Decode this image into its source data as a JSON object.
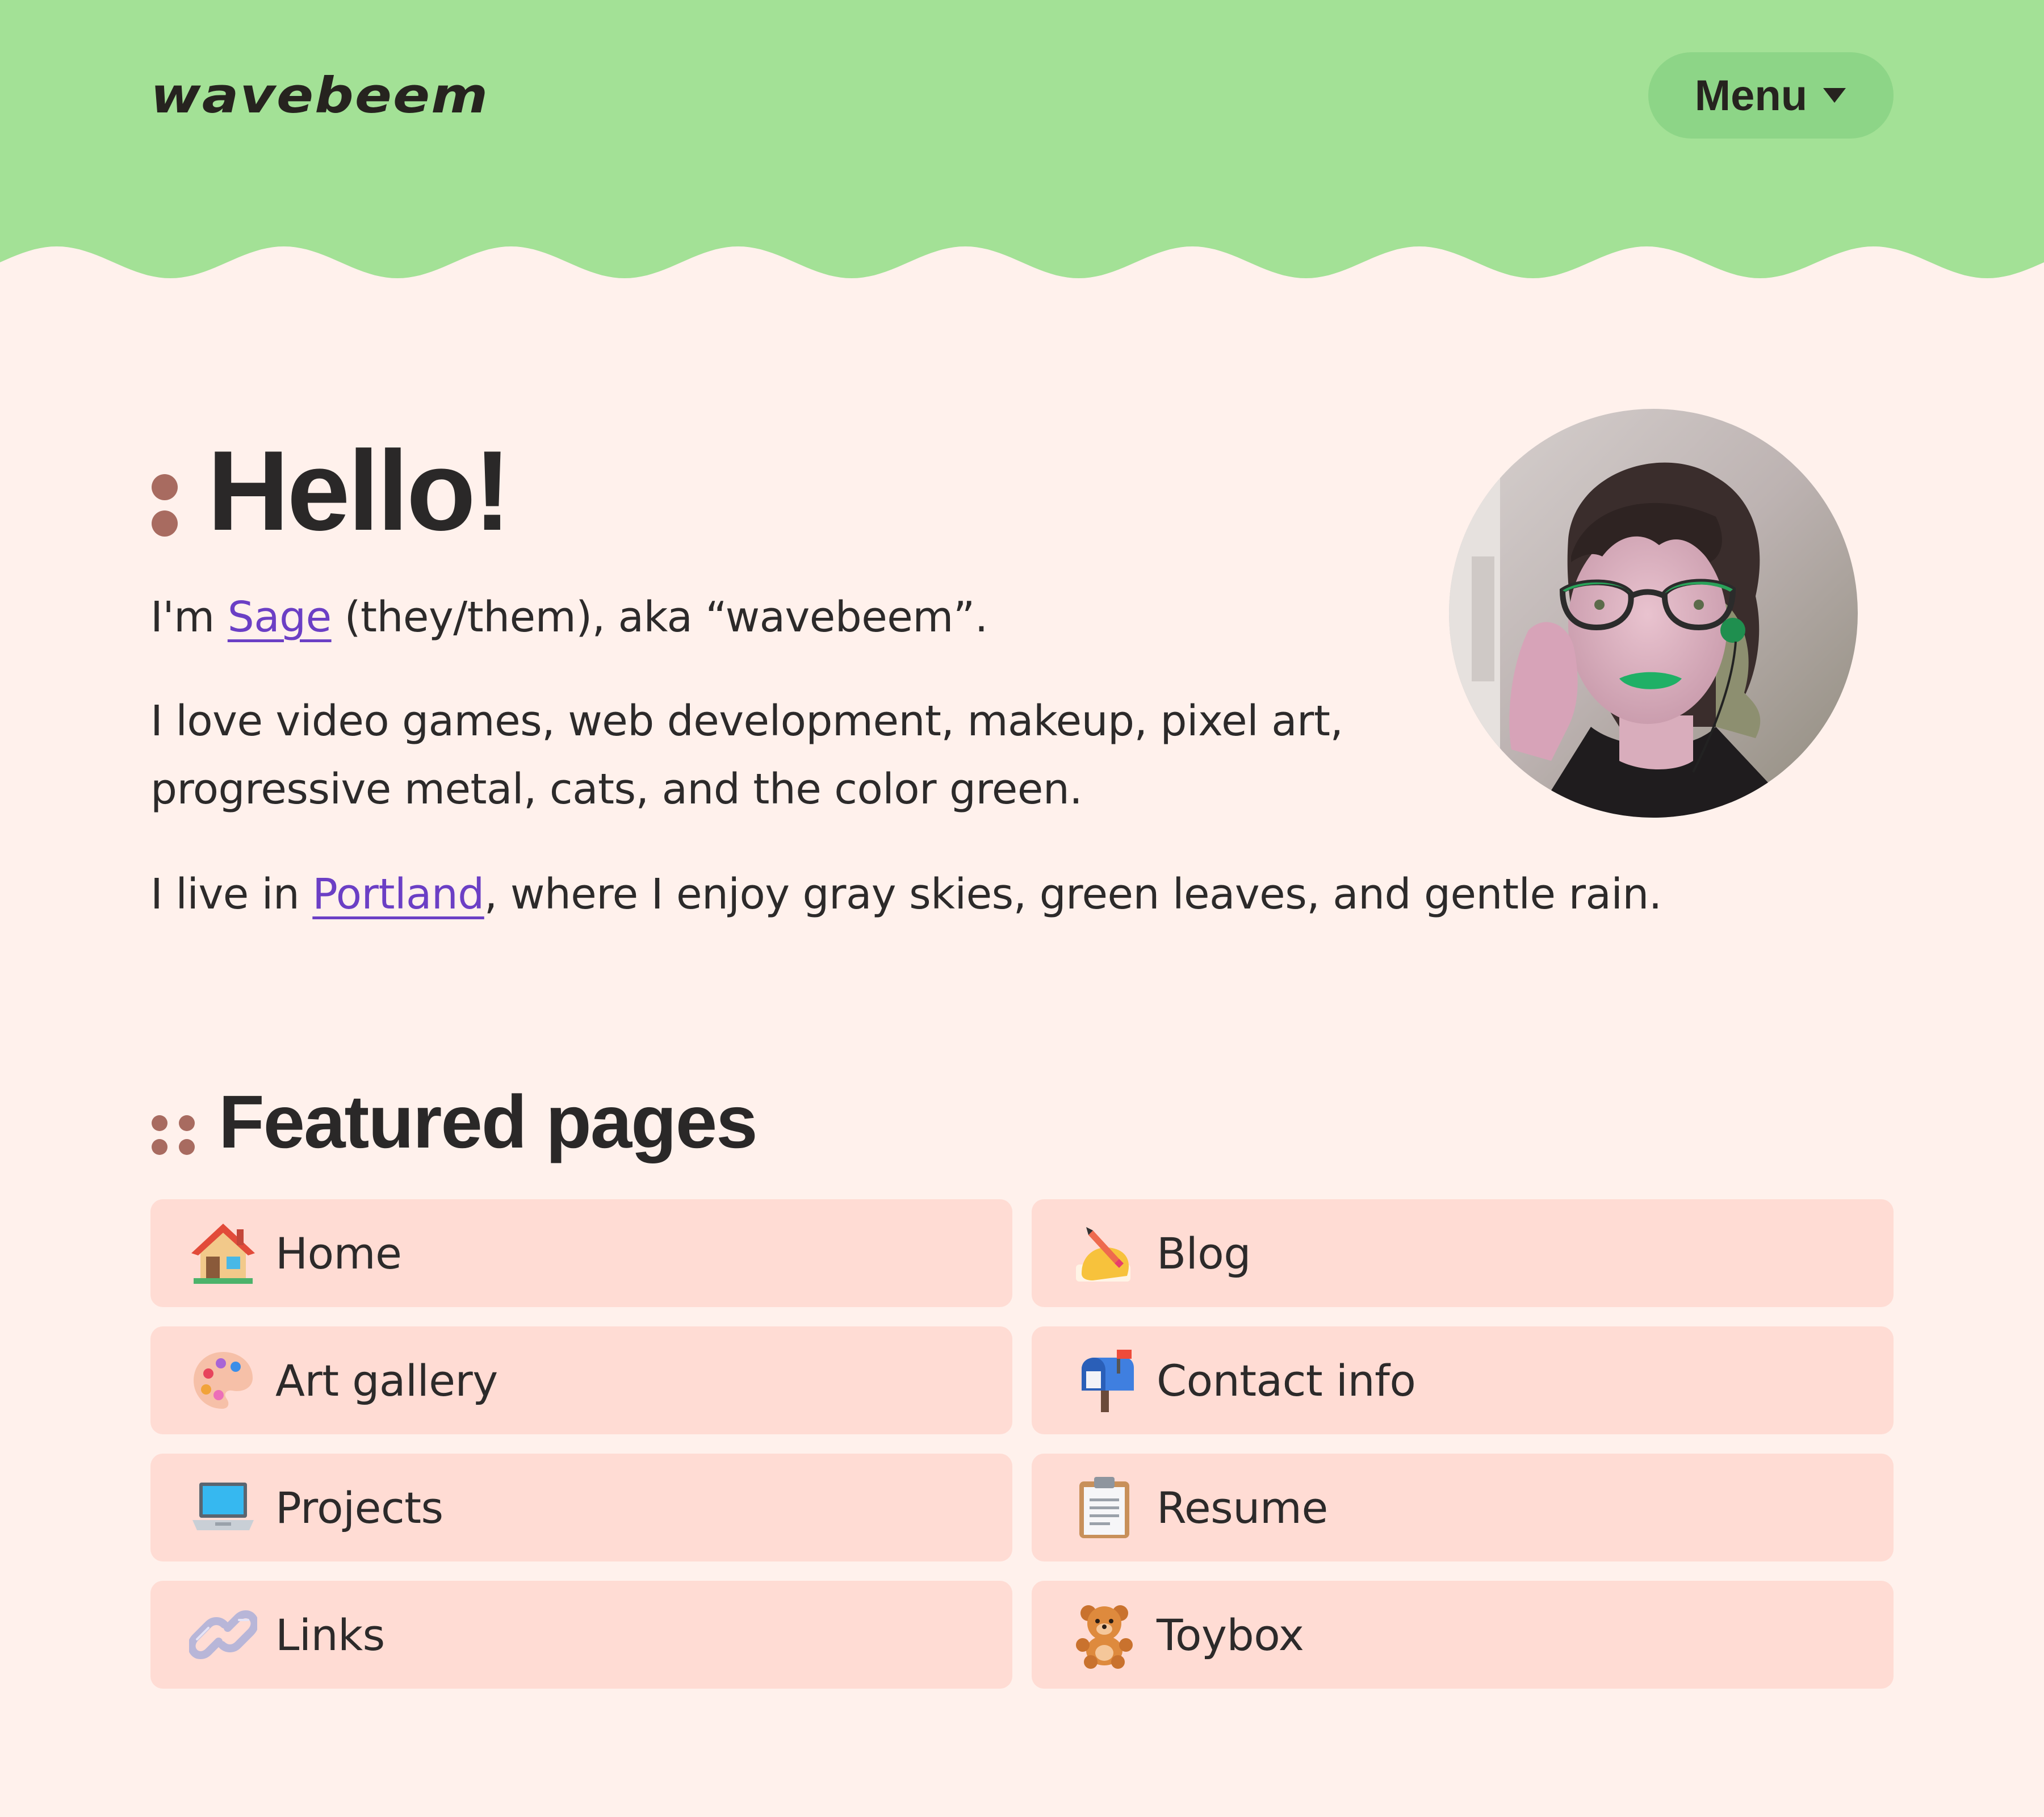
{
  "header": {
    "logo_text": "wavebeem",
    "menu_label": "Menu",
    "menu_icon": "caret-down-icon",
    "background_color": "#a3e196"
  },
  "hero": {
    "heading": "Hello!",
    "intro": {
      "prefix": "I'm ",
      "name_link": "Sage",
      "suffix": " (they/them), aka “wavebeem”."
    },
    "interests": "I love video games, web development, makeup, pixel art, progressive metal, cats, and the color green.",
    "location": {
      "prefix": "I live in ",
      "city_link": "Portland",
      "suffix": ", where I enjoy gray skies, green leaves, and gentle rain."
    },
    "link_color": "#6b3fc5",
    "avatar_alt": "profile photo"
  },
  "featured": {
    "heading": "Featured pages",
    "items": [
      {
        "label": "Home",
        "icon": "house-icon"
      },
      {
        "label": "Blog",
        "icon": "writing-hand-icon"
      },
      {
        "label": "Art gallery",
        "icon": "palette-icon"
      },
      {
        "label": "Contact info",
        "icon": "mailbox-icon"
      },
      {
        "label": "Projects",
        "icon": "laptop-icon"
      },
      {
        "label": "Resume",
        "icon": "clipboard-icon"
      },
      {
        "label": "Links",
        "icon": "link-icon"
      },
      {
        "label": "Toybox",
        "icon": "teddy-bear-icon"
      }
    ]
  },
  "colors": {
    "page_background": "#fff1ec",
    "card_background": "#ffdcd4",
    "bullet": "#a86b60",
    "menu_button": "#8dd587"
  }
}
